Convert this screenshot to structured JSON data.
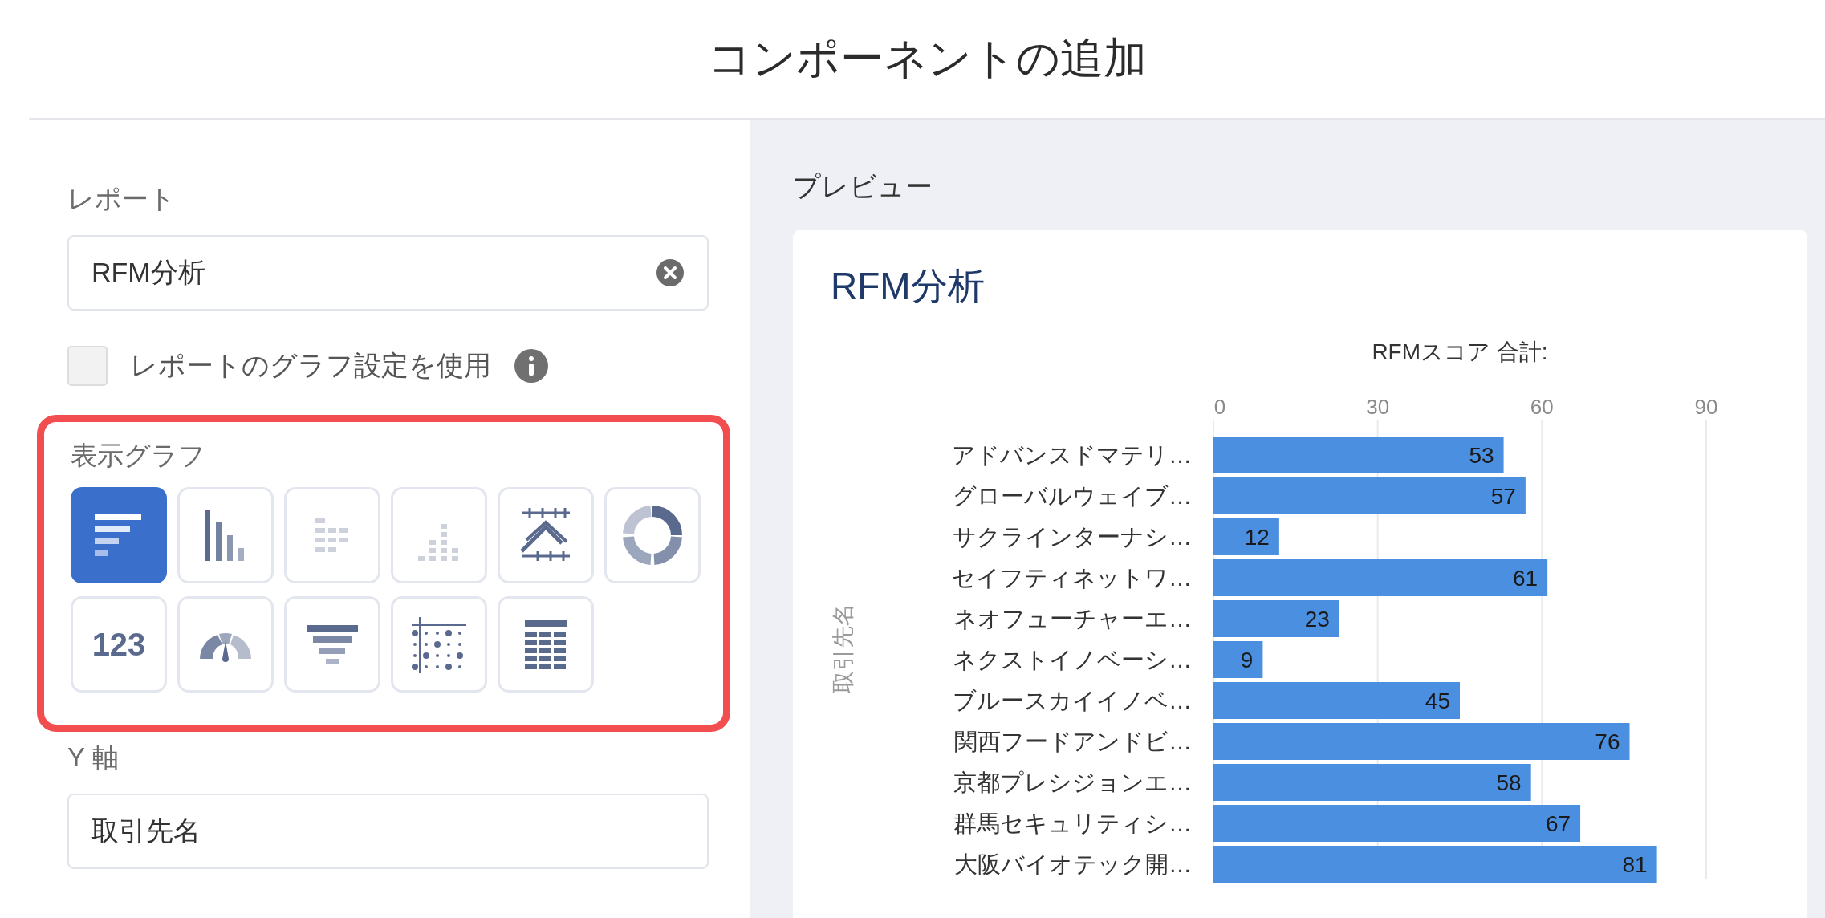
{
  "dialog": {
    "title": "コンポーネントの追加"
  },
  "report": {
    "label": "レポート",
    "value": "RFM分析"
  },
  "use_report_chart": {
    "label": "レポートのグラフ設定を使用",
    "checked": false
  },
  "chart_types": {
    "label": "表示グラフ",
    "items": [
      {
        "kind": "hbar",
        "selected": true,
        "disabled": false
      },
      {
        "kind": "column",
        "selected": false,
        "disabled": false
      },
      {
        "kind": "stacked-hbar",
        "selected": false,
        "disabled": true
      },
      {
        "kind": "stacked-column",
        "selected": false,
        "disabled": true
      },
      {
        "kind": "line",
        "selected": false,
        "disabled": false
      },
      {
        "kind": "donut",
        "selected": false,
        "disabled": false
      },
      {
        "kind": "metric",
        "label": "123",
        "selected": false,
        "disabled": false
      },
      {
        "kind": "gauge",
        "selected": false,
        "disabled": false
      },
      {
        "kind": "funnel",
        "selected": false,
        "disabled": false
      },
      {
        "kind": "scatter",
        "selected": false,
        "disabled": false
      },
      {
        "kind": "table",
        "selected": false,
        "disabled": false
      }
    ]
  },
  "y_axis": {
    "label": "Y 軸",
    "value": "取引先名"
  },
  "preview": {
    "label": "プレビュー",
    "card_title": "RFM分析",
    "chart_data": {
      "type": "bar",
      "orientation": "horizontal",
      "xlabel": "RFMスコア 合計:",
      "ylabel": "取引先名",
      "data_labels": true,
      "xticks": [
        0,
        30,
        60,
        90
      ],
      "xlim": [
        0,
        90
      ],
      "categories": [
        "アドバンスドマテリ…",
        "グローバルウェイブ…",
        "サクラインターナシ…",
        "セイフティネットワ…",
        "ネオフューチャーエ…",
        "ネクストイノベーシ…",
        "ブルースカイイノベ…",
        "関西フードアンドビ…",
        "京都プレシジョンエ…",
        "群馬セキュリティシ…",
        "大阪バイオテック開…"
      ],
      "values": [
        53,
        57,
        12,
        61,
        23,
        9,
        45,
        76,
        58,
        67,
        81
      ]
    }
  }
}
